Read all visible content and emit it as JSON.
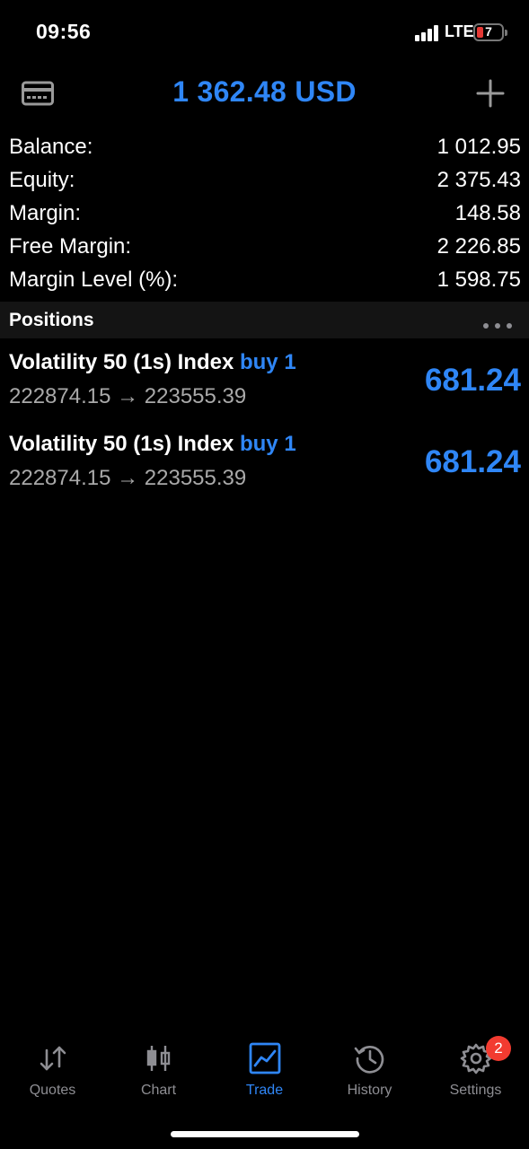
{
  "status": {
    "time": "09:56",
    "network": "LTE",
    "battery": "7"
  },
  "header": {
    "title": "1 362.48 USD",
    "left_icon": "card-icon",
    "right_icon": "plus-icon"
  },
  "summary": [
    {
      "label": "Balance:",
      "value": "1 012.95"
    },
    {
      "label": "Equity:",
      "value": "2 375.43"
    },
    {
      "label": "Margin:",
      "value": "148.58"
    },
    {
      "label": "Free Margin:",
      "value": "2 226.85"
    },
    {
      "label": "Margin Level (%):",
      "value": "1 598.75"
    }
  ],
  "positions": {
    "title": "Positions",
    "more_icon": "more-dots-icon",
    "items": [
      {
        "symbol": "Volatility 50 (1s) Index",
        "side": "buy 1",
        "prices": "222874.15 → 223555.39",
        "profit": "681.24"
      },
      {
        "symbol": "Volatility 50 (1s) Index",
        "side": "buy 1",
        "prices": "222874.15 → 223555.39",
        "profit": "681.24"
      }
    ]
  },
  "tabs": [
    {
      "label": "Quotes",
      "icon": "quotes-arrows-icon"
    },
    {
      "label": "Chart",
      "icon": "candlestick-icon"
    },
    {
      "label": "Trade",
      "icon": "trade-chart-icon",
      "active": true
    },
    {
      "label": "History",
      "icon": "history-clock-icon"
    },
    {
      "label": "Settings",
      "icon": "gear-icon",
      "badge": "2"
    }
  ],
  "colors": {
    "accent": "#2f86f6",
    "badge": "#f23b30",
    "muted": "#a9a9a9"
  }
}
